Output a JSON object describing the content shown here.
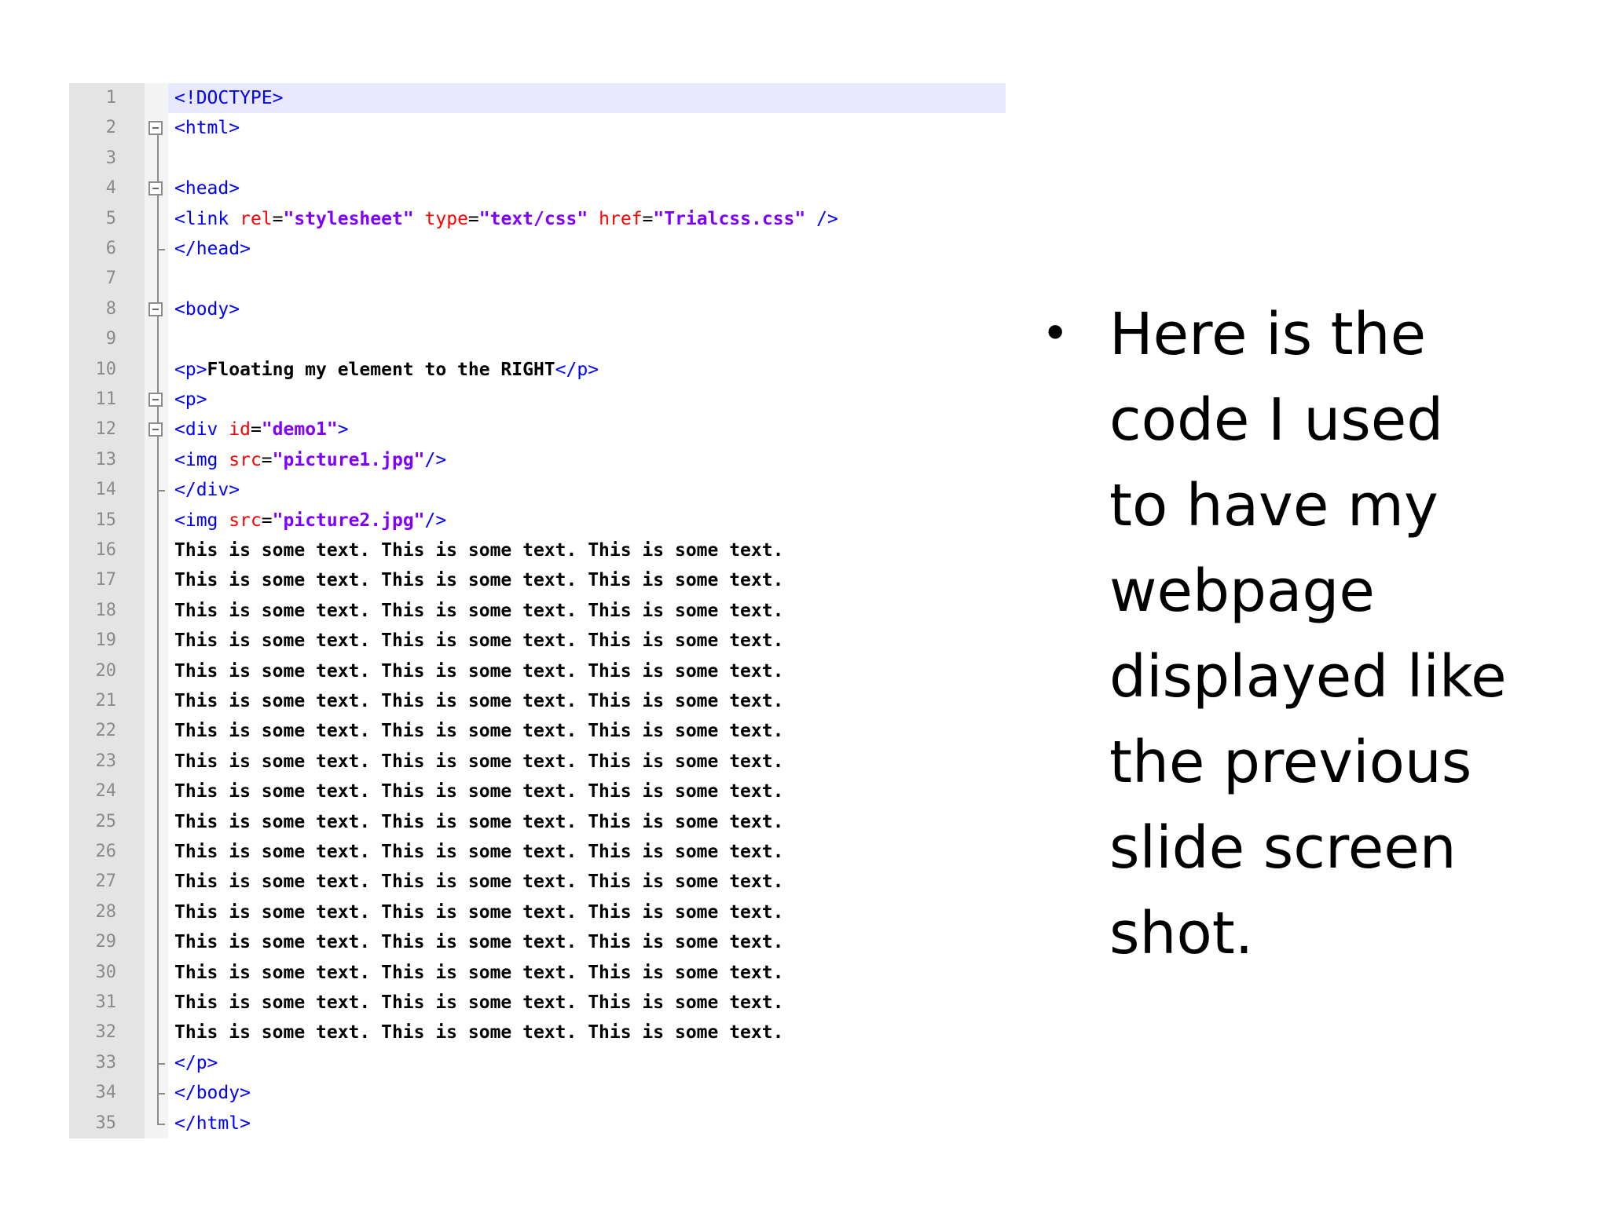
{
  "editor": {
    "current_line": 1,
    "lines": [
      {
        "n": "1",
        "tokens": [
          [
            "tag",
            "<!DOCTYPE>"
          ]
        ]
      },
      {
        "n": "2",
        "tokens": [
          [
            "tag",
            "<html>"
          ]
        ]
      },
      {
        "n": "3",
        "tokens": []
      },
      {
        "n": "4",
        "tokens": [
          [
            "tag",
            "<head>"
          ]
        ]
      },
      {
        "n": "5",
        "tokens": [
          [
            "tag",
            "<link "
          ],
          [
            "attr",
            "rel"
          ],
          [
            "plain",
            "="
          ],
          [
            "val",
            "\"stylesheet\""
          ],
          [
            "plain",
            " "
          ],
          [
            "attr",
            "type"
          ],
          [
            "plain",
            "="
          ],
          [
            "val",
            "\"text/css\""
          ],
          [
            "plain",
            " "
          ],
          [
            "attr",
            "href"
          ],
          [
            "plain",
            "="
          ],
          [
            "val",
            "\"Trialcss.css\""
          ],
          [
            "plain",
            " "
          ],
          [
            "tag",
            "/>"
          ]
        ]
      },
      {
        "n": "6",
        "tokens": [
          [
            "tag",
            "</head>"
          ]
        ]
      },
      {
        "n": "7",
        "tokens": []
      },
      {
        "n": "8",
        "tokens": [
          [
            "tag",
            "<body>"
          ]
        ]
      },
      {
        "n": "9",
        "tokens": []
      },
      {
        "n": "10",
        "tokens": [
          [
            "tag",
            "<p>"
          ],
          [
            "text",
            "Floating my element to the RIGHT"
          ],
          [
            "tag",
            "</p>"
          ]
        ]
      },
      {
        "n": "11",
        "tokens": [
          [
            "tag",
            "<p>"
          ]
        ]
      },
      {
        "n": "12",
        "tokens": [
          [
            "tag",
            "<div "
          ],
          [
            "attr",
            "id"
          ],
          [
            "plain",
            "="
          ],
          [
            "val",
            "\"demo1\""
          ],
          [
            "tag",
            ">"
          ]
        ]
      },
      {
        "n": "13",
        "tokens": [
          [
            "tag",
            "<img "
          ],
          [
            "attr",
            "src"
          ],
          [
            "plain",
            "="
          ],
          [
            "val",
            "\"picture1.jpg\""
          ],
          [
            "tag",
            "/>"
          ]
        ]
      },
      {
        "n": "14",
        "tokens": [
          [
            "tag",
            "</div>"
          ]
        ]
      },
      {
        "n": "15",
        "tokens": [
          [
            "tag",
            "<img "
          ],
          [
            "attr",
            "src"
          ],
          [
            "plain",
            "="
          ],
          [
            "val",
            "\"picture2.jpg\""
          ],
          [
            "tag",
            "/>"
          ]
        ]
      },
      {
        "n": "16",
        "tokens": [
          [
            "text",
            "This is some text. This is some text. This is some text."
          ]
        ]
      },
      {
        "n": "17",
        "tokens": [
          [
            "text",
            "This is some text. This is some text. This is some text."
          ]
        ]
      },
      {
        "n": "18",
        "tokens": [
          [
            "text",
            "This is some text. This is some text. This is some text."
          ]
        ]
      },
      {
        "n": "19",
        "tokens": [
          [
            "text",
            "This is some text. This is some text. This is some text."
          ]
        ]
      },
      {
        "n": "20",
        "tokens": [
          [
            "text",
            "This is some text. This is some text. This is some text."
          ]
        ]
      },
      {
        "n": "21",
        "tokens": [
          [
            "text",
            "This is some text. This is some text. This is some text."
          ]
        ]
      },
      {
        "n": "22",
        "tokens": [
          [
            "text",
            "This is some text. This is some text. This is some text."
          ]
        ]
      },
      {
        "n": "23",
        "tokens": [
          [
            "text",
            "This is some text. This is some text. This is some text."
          ]
        ]
      },
      {
        "n": "24",
        "tokens": [
          [
            "text",
            "This is some text. This is some text. This is some text."
          ]
        ]
      },
      {
        "n": "25",
        "tokens": [
          [
            "text",
            "This is some text. This is some text. This is some text."
          ]
        ]
      },
      {
        "n": "26",
        "tokens": [
          [
            "text",
            "This is some text. This is some text. This is some text."
          ]
        ]
      },
      {
        "n": "27",
        "tokens": [
          [
            "text",
            "This is some text. This is some text. This is some text."
          ]
        ]
      },
      {
        "n": "28",
        "tokens": [
          [
            "text",
            "This is some text. This is some text. This is some text."
          ]
        ]
      },
      {
        "n": "29",
        "tokens": [
          [
            "text",
            "This is some text. This is some text. This is some text."
          ]
        ]
      },
      {
        "n": "30",
        "tokens": [
          [
            "text",
            "This is some text. This is some text. This is some text."
          ]
        ]
      },
      {
        "n": "31",
        "tokens": [
          [
            "text",
            "This is some text. This is some text. This is some text."
          ]
        ]
      },
      {
        "n": "32",
        "tokens": [
          [
            "text",
            "This is some text. This is some text. This is some text."
          ]
        ]
      },
      {
        "n": "33",
        "tokens": [
          [
            "tag",
            "</p>"
          ]
        ]
      },
      {
        "n": "34",
        "tokens": [
          [
            "tag",
            "</body>"
          ]
        ]
      },
      {
        "n": "35",
        "tokens": [
          [
            "tag",
            "</html>"
          ]
        ]
      }
    ],
    "fold_open_lines": [
      "2",
      "4",
      "8",
      "11",
      "12"
    ],
    "fold_end_lines": [
      "6",
      "14",
      "33",
      "34",
      "35"
    ],
    "colors": {
      "tag": "#0000ff",
      "attr": "#ff0000",
      "value": "#8000ff",
      "text": "#000000",
      "current_line_highlight": "#e8e8ff",
      "gutter": "#e4e4e4"
    }
  },
  "bullet": {
    "icon": "bullet-dot",
    "glyph": "•",
    "text": "Here is the\ncode I used\nto have my\nwebpage\ndisplayed like\nthe previous\nslide screen\nshot."
  }
}
